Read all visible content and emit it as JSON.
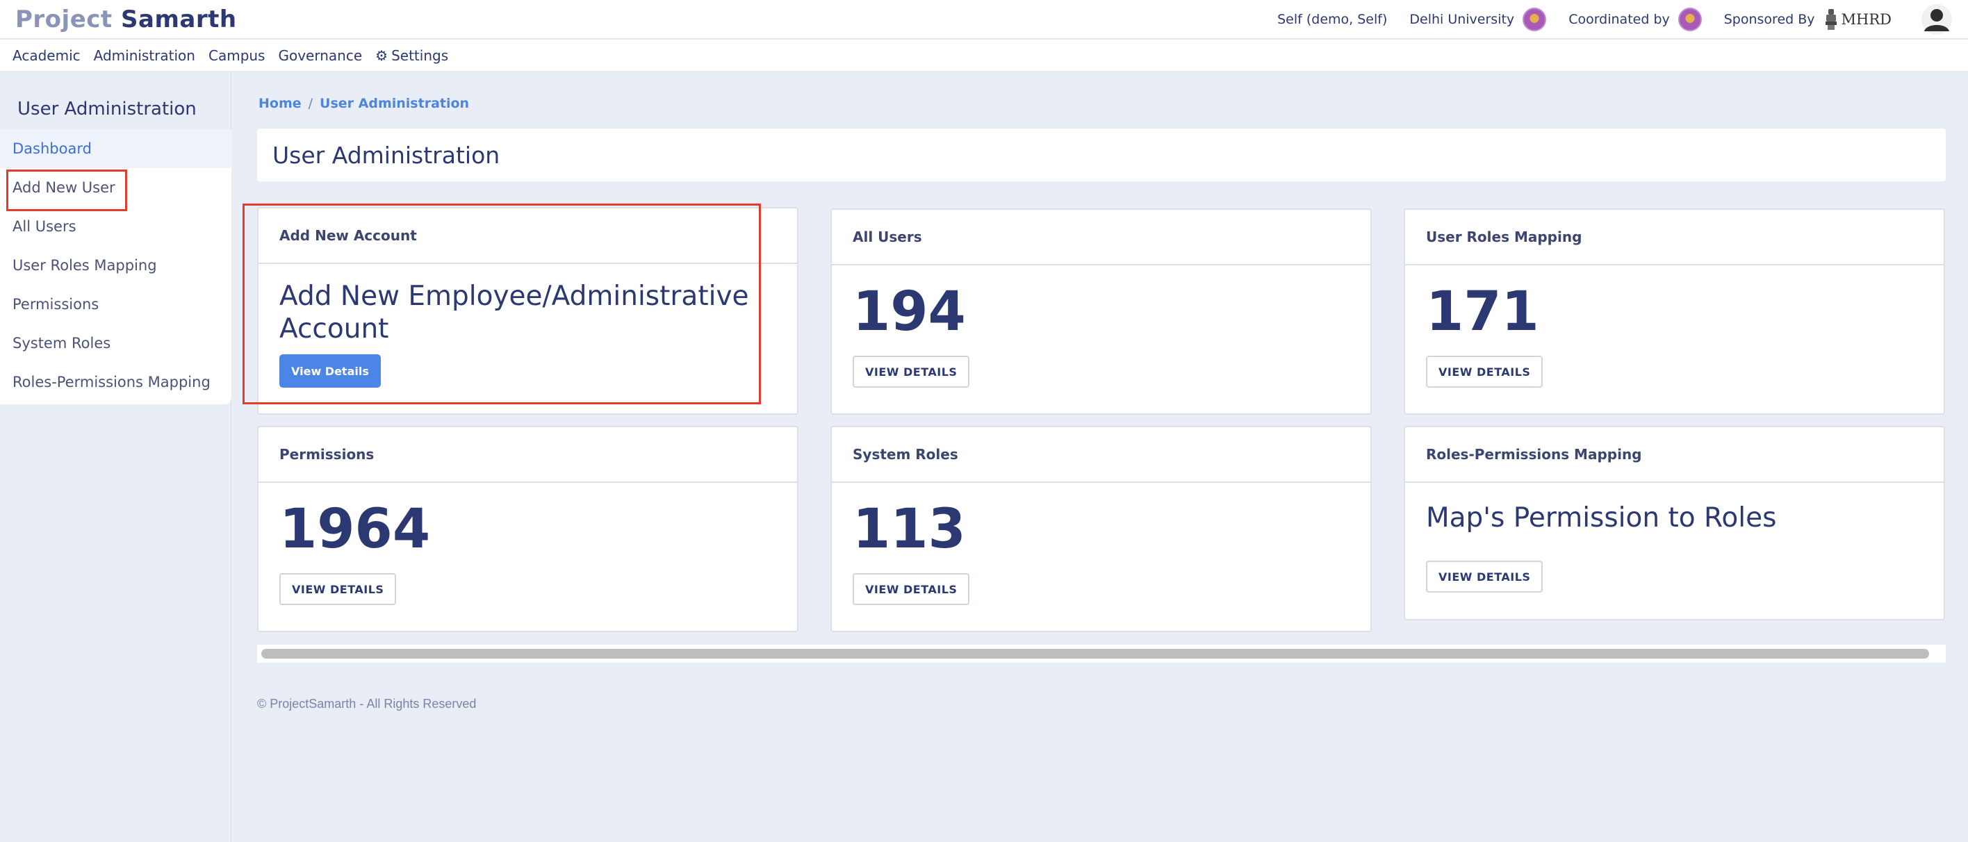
{
  "header": {
    "brand_part1": "Project",
    "brand_part2": "Samarth",
    "user": "Self (demo, Self)",
    "university": "Delhi University",
    "coordinated_by": "Coordinated by",
    "sponsored_by": "Sponsored By",
    "sponsor_name": "MHRD"
  },
  "nav": {
    "items": [
      "Academic",
      "Administration",
      "Campus",
      "Governance",
      "Settings"
    ]
  },
  "sidebar": {
    "title": "User Administration",
    "items": [
      "Dashboard",
      "Add New User",
      "All Users",
      "User Roles Mapping",
      "Permissions",
      "System Roles",
      "Roles-Permissions Mapping"
    ]
  },
  "breadcrumb": {
    "home": "Home",
    "separator": "/",
    "current": "User Administration"
  },
  "page_title": "User Administration",
  "cards": [
    {
      "header": "Add New Account",
      "text": "Add New Employee/Administrative Account",
      "button": "View Details"
    },
    {
      "header": "All Users",
      "value": "194",
      "button": "VIEW DETAILS"
    },
    {
      "header": "User Roles Mapping",
      "value": "171",
      "button": "VIEW DETAILS"
    },
    {
      "header": "Permissions",
      "value": "1964",
      "button": "VIEW DETAILS"
    },
    {
      "header": "System Roles",
      "value": "113",
      "button": "VIEW DETAILS"
    },
    {
      "header": "Roles-Permissions Mapping",
      "text": "Map's Permission to Roles",
      "button": "VIEW DETAILS"
    }
  ],
  "footer": "© ProjectSamarth - All Rights Reserved",
  "colors": {
    "accent": "#4b86e6",
    "navy": "#2c3871",
    "highlight": "#e23c2c",
    "background": "#e9edf6"
  }
}
